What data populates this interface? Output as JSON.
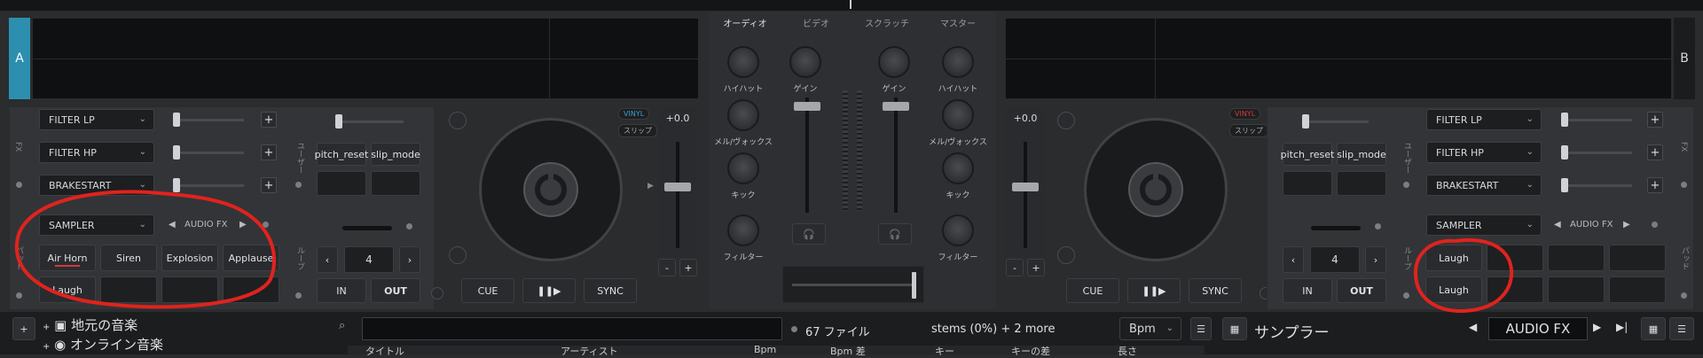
{
  "deckA": {
    "letter": "A",
    "fx_label": "FX",
    "fx": [
      {
        "name": "FILTER LP"
      },
      {
        "name": "FILTER HP"
      },
      {
        "name": "BRAKESTART"
      }
    ],
    "user_label": "ユーザー",
    "user_buttons": [
      "pitch_reset",
      "slip_mode"
    ],
    "sampler_label": "パッド",
    "sampler_dropdown": "SAMPLER",
    "pad_mode": "AUDIO FX",
    "pads": [
      "Air Horn",
      "Siren",
      "Explosion",
      "Applause",
      "Laugh",
      "",
      "",
      ""
    ],
    "loop_label": "ループ",
    "loop_value": "4",
    "in_label": "IN",
    "out_label": "OUT",
    "vinyl": "VINYL",
    "slip": "スリップ",
    "pitch": "+0.0",
    "cue": "CUE",
    "play": "❚❚▶",
    "sync": "SYNC",
    "minus": "-",
    "plus": "+"
  },
  "deckB": {
    "letter": "B",
    "fx": [
      {
        "name": "FILTER LP"
      },
      {
        "name": "FILTER HP"
      },
      {
        "name": "BRAKESTART"
      }
    ],
    "user_label": "ユーザー",
    "user_buttons": [
      "pitch_reset",
      "slip_mode"
    ],
    "sampler_label": "パッド",
    "sampler_dropdown": "SAMPLER",
    "pad_mode": "AUDIO FX",
    "pads": [
      "Laugh",
      "",
      "",
      "",
      "Laugh",
      "",
      "",
      ""
    ],
    "loop_label": "ループ",
    "loop_value": "4",
    "in_label": "IN",
    "out_label": "OUT",
    "vinyl": "VINYL",
    "slip": "スリップ",
    "pitch": "+0.0",
    "cue": "CUE",
    "play": "❚❚▶",
    "sync": "SYNC",
    "fx_label": "FX",
    "minus": "-",
    "plus": "+"
  },
  "mixer": {
    "tabs": [
      "オーディオ",
      "ビデオ",
      "スクラッチ",
      "マスター"
    ],
    "left_knobs": [
      "ハイハット",
      "メル/ヴォックス",
      "キック",
      "フィルター"
    ],
    "right_knobs": [
      "ハイハット",
      "メル/ヴォックス",
      "キック",
      "フィルター"
    ],
    "gain": "ゲイン"
  },
  "browser": {
    "tree": [
      "地元の音楽",
      "オンライン音楽"
    ],
    "file_count": "67 ファイル",
    "stems": "stems (0%) + 2 more",
    "sort": "Bpm",
    "columns": [
      "タイトル",
      "アーティスト",
      "Bpm",
      "Bpm 差",
      "キー",
      "キーの差",
      "長さ"
    ],
    "sampler_title": "サンプラー",
    "sampler_mode": "AUDIO FX"
  },
  "colors": {
    "accent_blue": "#2c8fb0",
    "annotation_red": "#e0231e",
    "vinyl_blue": "#3aa0d0",
    "vinyl_red": "#d03a3a"
  }
}
